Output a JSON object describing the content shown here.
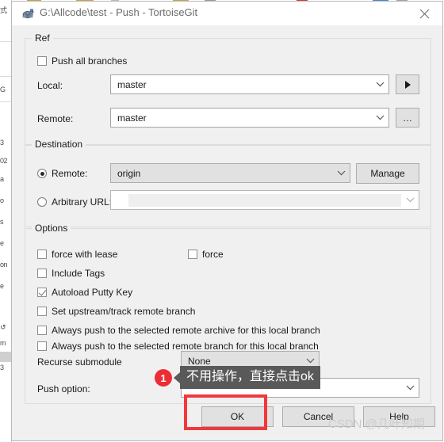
{
  "window": {
    "title": "G:\\Allcode\\test - Push - TortoiseGit",
    "app_icon": "tortoisegit-turtle-icon",
    "close_label": "✕"
  },
  "ref_group": {
    "title": "Ref",
    "push_all_branches": {
      "label": "Push all branches",
      "checked": false
    },
    "local": {
      "label": "Local:",
      "value": "master"
    },
    "remote": {
      "label": "Remote:",
      "value": "master"
    },
    "local_browse_button": "▶",
    "remote_browse_button": "…"
  },
  "destination_group": {
    "title": "Destination",
    "remote_radio": {
      "label": "Remote:",
      "selected": true,
      "value": "origin"
    },
    "arbitrary_url_radio": {
      "label": "Arbitrary URL:",
      "selected": false,
      "value": ""
    },
    "manage_button": "Manage"
  },
  "options_group": {
    "title": "Options",
    "checkboxes": [
      {
        "label": "force with lease",
        "checked": false
      },
      {
        "label": "force",
        "checked": false
      },
      {
        "label": "Include Tags",
        "checked": false
      },
      {
        "label": "Autoload Putty Key",
        "checked": true
      },
      {
        "label": "Set upstream/track remote branch",
        "checked": false
      },
      {
        "label": "Always push to the selected remote archive for this local branch",
        "checked": false
      },
      {
        "label": "Always push to the selected remote branch for this local branch",
        "checked": false
      }
    ],
    "recurse_submodule": {
      "label": "Recurse submodule",
      "value": "None"
    },
    "push_option": {
      "label": "Push option:",
      "value": ""
    }
  },
  "buttons": {
    "ok": "OK",
    "cancel": "Cancel",
    "help": "Help"
  },
  "annotation": {
    "badge": "1",
    "tooltip": "不用操作，直接点击ok",
    "highlight_color": "#f2383b",
    "badge_color": "#ed2d35"
  },
  "watermark": {
    "text": "CSDN @几叶知期"
  },
  "background_window": {
    "fragments": [
      "式",
      "G",
      "3",
      "02",
      "a",
      "o",
      "s",
      "e",
      "on",
      "e",
      "↺",
      "m",
      "3"
    ]
  }
}
